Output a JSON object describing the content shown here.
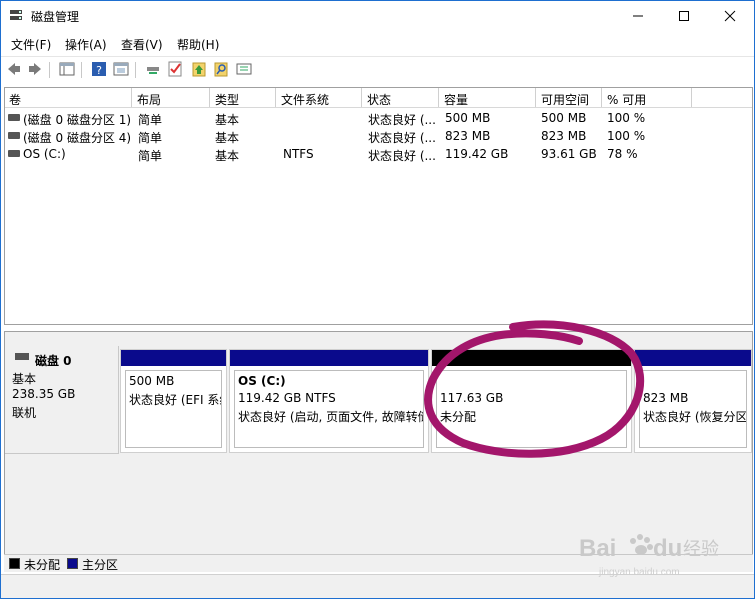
{
  "window": {
    "title": "磁盘管理"
  },
  "menu": [
    "文件(F)",
    "操作(A)",
    "查看(V)",
    "帮助(H)"
  ],
  "toolbar_icons": [
    "back-icon",
    "forward-icon",
    "console-tree-icon",
    "help-icon",
    "properties-icon",
    "connect-icon",
    "checklist-icon",
    "upload-icon",
    "search-icon",
    "list-icon"
  ],
  "volume_list": {
    "columns": [
      "卷",
      "布局",
      "类型",
      "文件系统",
      "状态",
      "容量",
      "可用空间",
      "% 可用"
    ],
    "rows": [
      [
        "(磁盘 0 磁盘分区 1)",
        "简单",
        "基本",
        "",
        "状态良好 (...",
        "500 MB",
        "500 MB",
        "100 %"
      ],
      [
        "(磁盘 0 磁盘分区 4)",
        "简单",
        "基本",
        "",
        "状态良好 (...",
        "823 MB",
        "823 MB",
        "100 %"
      ],
      [
        "OS (C:)",
        "简单",
        "基本",
        "NTFS",
        "状态良好 (...",
        "119.42 GB",
        "93.61 GB",
        "78 %"
      ]
    ]
  },
  "disk": {
    "name": "磁盘 0",
    "type": "基本",
    "size": "238.35 GB",
    "status": "联机",
    "partitions": [
      {
        "title": "",
        "line1": "500 MB",
        "line2": "状态良好 (EFI 系统分区)",
        "bar": "#0a0a8c"
      },
      {
        "title": "OS (C:)",
        "line1": "119.42 GB NTFS",
        "line2": "状态良好 (启动, 页面文件, 故障转储, 主分区)",
        "bar": "#0a0a8c"
      },
      {
        "title": "",
        "line1": "117.63 GB",
        "line2": "未分配",
        "bar": "#000000"
      },
      {
        "title": "",
        "line1": "823 MB",
        "line2": "状态良好 (恢复分区)",
        "bar": "#0a0a8c"
      }
    ]
  },
  "legend": [
    {
      "label": "未分配",
      "color": "#000000"
    },
    {
      "label": "主分区",
      "color": "#0a0a8c"
    }
  ],
  "annotation_color": "#a3166b",
  "watermark": {
    "brand": "Bai",
    "suffix": "du",
    "cn": "经验",
    "url": "jingyan.baidu.com"
  }
}
